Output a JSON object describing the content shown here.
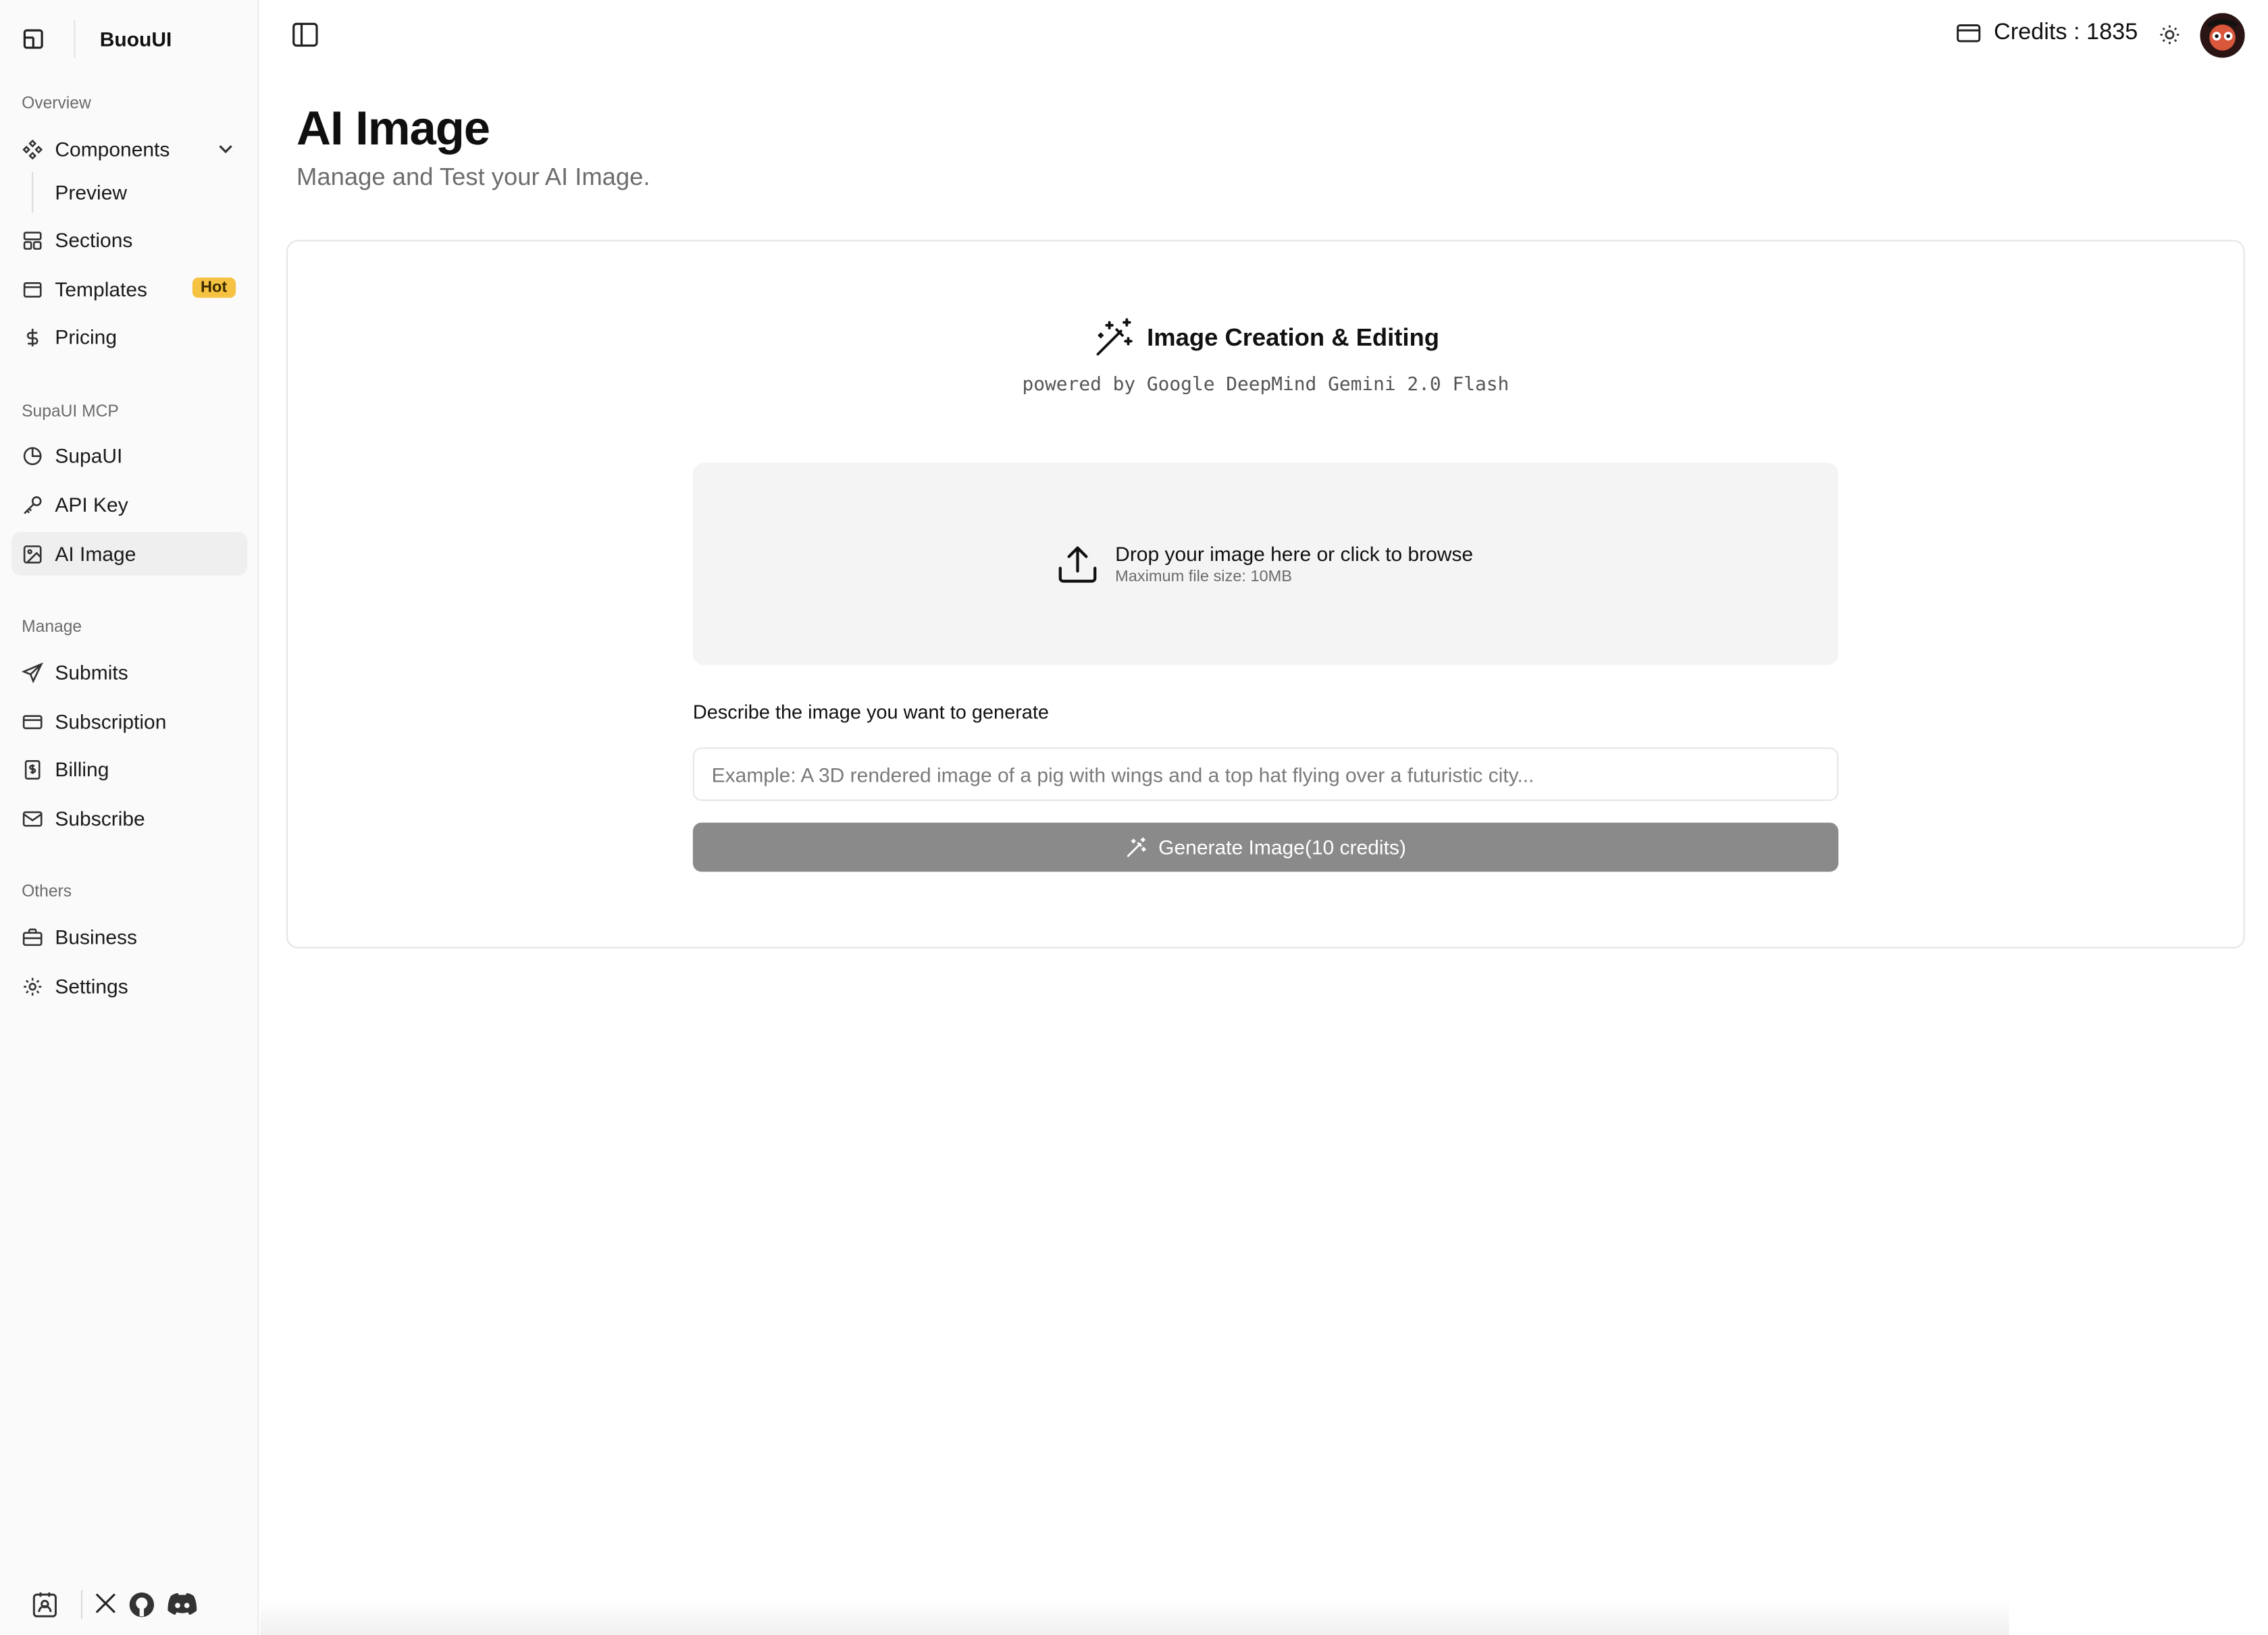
{
  "brand": {
    "name": "BuouUI"
  },
  "sidebar": {
    "groups": [
      {
        "label": "Overview"
      },
      {
        "label": "SupaUI MCP"
      },
      {
        "label": "Manage"
      },
      {
        "label": "Others"
      }
    ],
    "overview": {
      "components": "Components",
      "preview": "Preview",
      "sections": "Sections",
      "templates": "Templates",
      "templates_badge": "Hot",
      "pricing": "Pricing"
    },
    "mcp": {
      "supaui": "SupaUI",
      "api_key": "API Key",
      "ai_image": "AI Image"
    },
    "manage": {
      "submits": "Submits",
      "subscription": "Subscription",
      "billing": "Billing",
      "subscribe": "Subscribe"
    },
    "others": {
      "business": "Business",
      "settings": "Settings"
    }
  },
  "header": {
    "credits": "Credits : 1835"
  },
  "page": {
    "title": "AI Image",
    "subtitle": "Manage and Test your AI Image."
  },
  "panel": {
    "title": "Image Creation & Editing",
    "powered_by": "powered by Google DeepMind Gemini 2.0 Flash",
    "dropzone_main": "Drop your image here or click to browse",
    "dropzone_sub": "Maximum file size: 10MB",
    "prompt_label": "Describe the image you want to generate",
    "prompt_placeholder": "Example: A 3D rendered image of a pig with wings and a top hat flying over a futuristic city...",
    "prompt_value": "",
    "generate_label": "Generate Image(10 credits)"
  },
  "colors": {
    "badge_hot": "#f5c242",
    "button_disabled": "#8a8a8a",
    "sidebar_bg": "#fafafa",
    "active_bg": "#efefef"
  }
}
